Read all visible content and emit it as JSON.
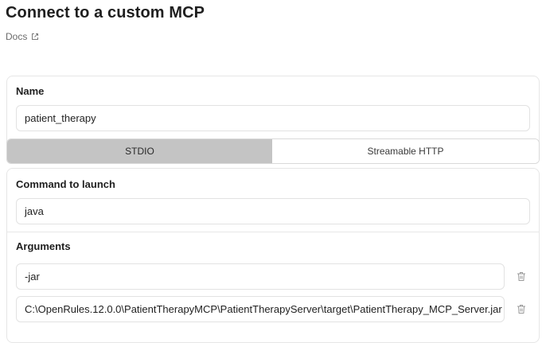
{
  "header": {
    "title": "Connect to a custom MCP",
    "docs_label": "Docs"
  },
  "name_section": {
    "label": "Name",
    "value": "patient_therapy"
  },
  "transport": {
    "tabs": [
      "STDIO",
      "Streamable HTTP"
    ],
    "selected": "STDIO"
  },
  "command_section": {
    "label": "Command to launch",
    "value": "java"
  },
  "arguments_section": {
    "label": "Arguments",
    "items": [
      "-jar",
      "C:\\OpenRules.12.0.0\\PatientTherapyMCP\\PatientTherapyServer\\target\\PatientTherapy_MCP_Server.jar"
    ]
  },
  "icons": {
    "docs": "external-link-icon",
    "delete": "trash-icon"
  },
  "colors": {
    "selected_tab_bg": "#c4c4c4",
    "border": "#e2e2e2",
    "muted_text": "#6b6b6b"
  }
}
